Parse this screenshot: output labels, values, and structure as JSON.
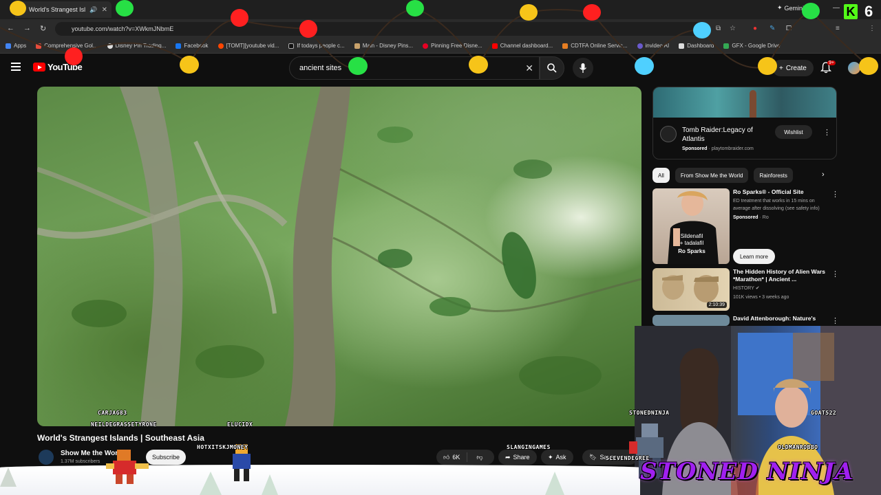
{
  "browser": {
    "tab_title": "World's Strangest Islan",
    "gemini_label": "Gemini",
    "url": "youtube.com/watch?v=XWkmJNbmE",
    "bookmarks": [
      "Apps",
      "Comprehensive Gol...",
      "Disney Pin Trading...",
      "Facebook",
      "[TOMT][youtube vid...",
      "If todays people c...",
      "Main - Disney Pins...",
      "Pinning Free Disne...",
      "Channel dashboard...",
      "CDTFA Online Servic...",
      "invideo AI",
      "Dashboard",
      "GFX - Google Drive"
    ]
  },
  "youtube": {
    "logo_text": "YouTube",
    "search_value": "ancient sites",
    "create_label": "Create",
    "notif_badge": "9+"
  },
  "video": {
    "title": "World's Strangest Islands | Southeast Asia",
    "channel": "Show Me the World",
    "subscribers": "1.37M subscribers",
    "subscribe_label": "Subscribe",
    "likes": "6K",
    "share_label": "Share",
    "ask_label": "Ask",
    "save_label": "Save"
  },
  "sidebar": {
    "ad": {
      "title": "Tomb Raider:Legacy of Atlantis",
      "sponsored": "Sponsored",
      "domain": "playtombraider.com",
      "wishlist_label": "Wishlist"
    },
    "chips": [
      "All",
      "From Show Me the World",
      "Rainforests"
    ],
    "recommendations": [
      {
        "title": "Ro Sparks® - Official Site",
        "desc": "ED treatment that works in 15 mins on average after dissolving (see safety info)",
        "sponsored": "Sponsored",
        "advertiser": "Ro",
        "cta": "Learn more",
        "thumb_text_1": "Sildenafil",
        "thumb_text_2": "+ tadalafil",
        "thumb_text_3": "Ro Sparks"
      },
      {
        "title": "The Hidden History of Alien Wars *Marathon* | Ancient ...",
        "channel": "HISTORY",
        "meta": "101K views • 3 weeks ago",
        "duration": "2:10:39"
      },
      {
        "title": "David Attenborough: Nature's"
      }
    ]
  },
  "overlay": {
    "usernames": [
      "CARJAG83",
      "NEILDEGRASSETYRONE",
      "ELUCIDX",
      "HOTXITSKJMONEY",
      "SLANGINGAMES",
      "SLEVENDEGREE",
      "STONEDNINJA",
      "GOATS22",
      "OLDMANROBBO"
    ],
    "brand": "STONED NINJA",
    "kick_letter": "K",
    "kick_count": "6"
  },
  "colors": {
    "yt_red": "#ff0000",
    "brand_purple": "#a020f0",
    "kick_green": "#53fc18"
  }
}
